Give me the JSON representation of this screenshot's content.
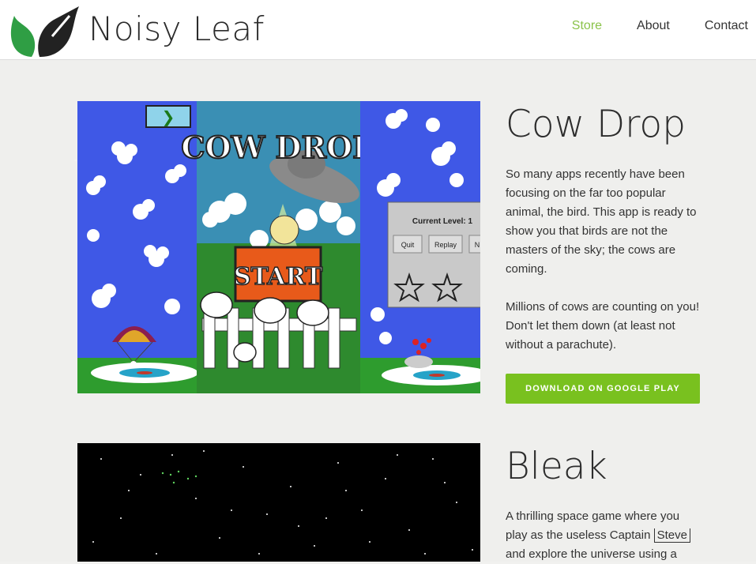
{
  "brand": {
    "name": "Noisy Leaf"
  },
  "nav": [
    {
      "label": "Store",
      "active": true
    },
    {
      "label": "About",
      "active": false
    },
    {
      "label": "Contact",
      "active": false
    }
  ],
  "products": [
    {
      "title": "Cow Drop",
      "description": [
        "So many apps recently have been focusing on the far too popular animal, the bird. This app is ready to show you that birds are not the masters of the sky; the cows are coming.",
        "Millions of cows are counting on you! Don't let them down (at least not without a parachute)."
      ],
      "download_label": "DOWNLOAD ON GOOGLE PLAY",
      "screenshot": {
        "game_title": "COW DROP",
        "start_label": "START",
        "level_text": "Current Level: 1",
        "buttons": [
          "Quit",
          "Replay",
          "N"
        ],
        "arrow": "❯"
      }
    },
    {
      "title": "Bleak",
      "description_pre": "A thrilling space game where you play as the useless Captain",
      "description_highlight": "Steve",
      "description_post": "and explore the universe using a"
    }
  ],
  "colors": {
    "accent": "#8bc34a",
    "button": "#79c11f"
  }
}
